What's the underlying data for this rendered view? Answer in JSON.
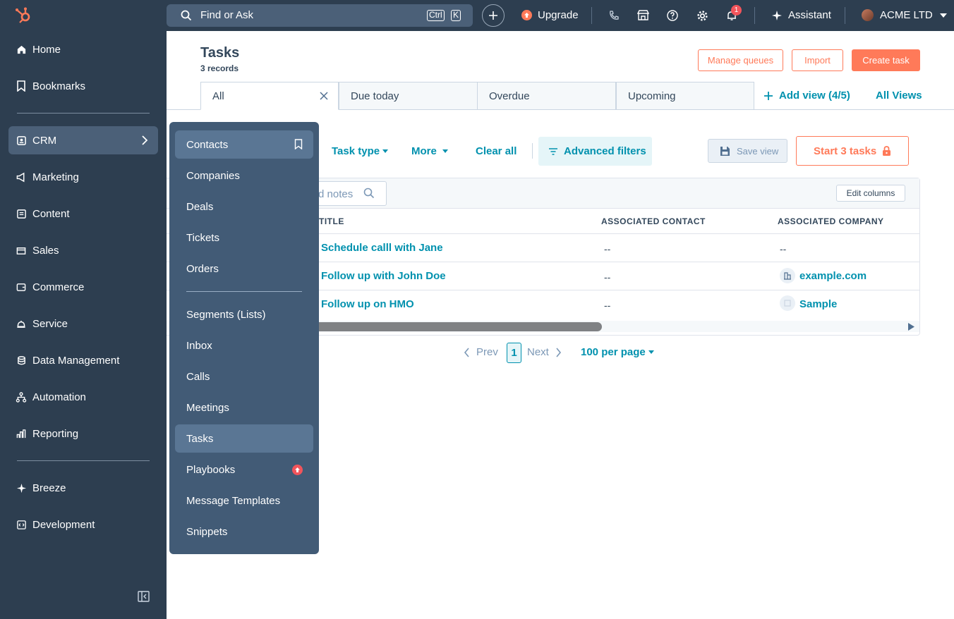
{
  "topbar": {
    "search_placeholder": "Find or Ask",
    "kbd_ctrl": "Ctrl",
    "kbd_k": "K",
    "upgrade_label": "Upgrade",
    "notification_count": "1",
    "assistant_label": "Assistant",
    "account_name": "ACME LTD"
  },
  "sidebar": {
    "items": [
      {
        "label": "Home",
        "icon": "home-icon"
      },
      {
        "label": "Bookmarks",
        "icon": "bookmark-icon"
      },
      {
        "label": "CRM",
        "icon": "crm-icon"
      },
      {
        "label": "Marketing",
        "icon": "megaphone-icon"
      },
      {
        "label": "Content",
        "icon": "content-icon"
      },
      {
        "label": "Sales",
        "icon": "sales-icon"
      },
      {
        "label": "Commerce",
        "icon": "wallet-icon"
      },
      {
        "label": "Service",
        "icon": "service-bell-icon"
      },
      {
        "label": "Data Management",
        "icon": "database-icon"
      },
      {
        "label": "Automation",
        "icon": "automation-icon"
      },
      {
        "label": "Reporting",
        "icon": "bar-chart-icon"
      },
      {
        "label": "Breeze",
        "icon": "sparkle-icon"
      },
      {
        "label": "Development",
        "icon": "code-icon"
      }
    ]
  },
  "flyout": {
    "items": [
      {
        "label": "Contacts"
      },
      {
        "label": "Companies"
      },
      {
        "label": "Deals"
      },
      {
        "label": "Tickets"
      },
      {
        "label": "Orders"
      },
      {
        "label": "Segments (Lists)"
      },
      {
        "label": "Inbox"
      },
      {
        "label": "Calls"
      },
      {
        "label": "Meetings"
      },
      {
        "label": "Tasks"
      },
      {
        "label": "Playbooks"
      },
      {
        "label": "Message Templates"
      },
      {
        "label": "Snippets"
      }
    ]
  },
  "header": {
    "title": "Tasks",
    "record_count": "3 records",
    "manage_queues": "Manage queues",
    "import": "Import",
    "create_task": "Create task"
  },
  "tabs": [
    {
      "label": "All"
    },
    {
      "label": "Due today"
    },
    {
      "label": "Overdue"
    },
    {
      "label": "Upcoming"
    }
  ],
  "views": {
    "add_view": "Add view (4/5)",
    "all_views": "All Views"
  },
  "filters": {
    "task_type": "Task type",
    "more": "More",
    "clear_all": "Clear all",
    "advanced": "Advanced filters",
    "save_view": "Save view",
    "start_tasks": "Start 3 tasks"
  },
  "table": {
    "search_placeholder": "d notes",
    "edit_columns": "Edit columns",
    "columns": [
      "TITLE",
      "ASSOCIATED CONTACT",
      "ASSOCIATED COMPANY"
    ],
    "rows": [
      {
        "title": "Schedule calll with Jane",
        "contact": "--",
        "company": "--"
      },
      {
        "title": "Follow up with John Doe",
        "contact": "--",
        "company": "example.com"
      },
      {
        "title": "Follow up on HMO",
        "contact": "--",
        "company": "Sample"
      }
    ]
  },
  "pagination": {
    "prev": "Prev",
    "page": "1",
    "next": "Next",
    "per_page": "100 per page"
  },
  "colors": {
    "sidebar": "#2d3e50",
    "accent_orange": "#ff7a59",
    "link_teal": "#0091ae",
    "flyout": "#425b76"
  }
}
